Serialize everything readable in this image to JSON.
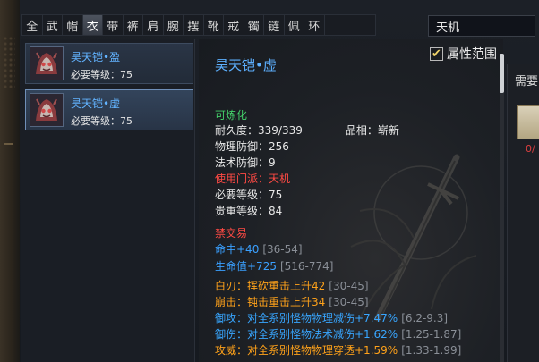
{
  "tabs": [
    "全",
    "武",
    "帽",
    "衣",
    "带",
    "裤",
    "肩",
    "腕",
    "摆",
    "靴",
    "戒",
    "镯",
    "链",
    "佩",
    "环"
  ],
  "active_tab_index": 3,
  "search": {
    "value": "天机"
  },
  "items": [
    {
      "name": "昊天铠•盈",
      "req": "必要等级：75",
      "selected": false
    },
    {
      "name": "昊天铠•虚",
      "req": "必要等级：75",
      "selected": true
    }
  ],
  "attr_filter": {
    "checked": true,
    "label": "属性范围",
    "check_glyph": "✔"
  },
  "detail": {
    "title": "昊天铠•虚",
    "refinable": "可炼化",
    "durability_label": "耐久度：339/339",
    "quality_label": "品相：崭新",
    "phys_def": "物理防御：256",
    "mag_def": "法术防御：9",
    "faction": "使用门派：天机",
    "req_level": "必要等级：75",
    "prestige_level": "贵重等级：84",
    "no_trade": "禁交易",
    "stats": [
      {
        "text": "命中+40",
        "range": "[36-54]",
        "color": "blue"
      },
      {
        "text": "生命值+725",
        "range": "[516-774]",
        "color": "blue"
      }
    ],
    "specials": [
      {
        "text": "白刃：挥砍重击上升42",
        "range": "[30-45]",
        "color": "orange"
      },
      {
        "text": "崩击：钝击重击上升34",
        "range": "[30-45]",
        "color": "orange"
      },
      {
        "text": "御攻：对全系别怪物物理减伤+7.47%",
        "range": "[6.2-9.3]",
        "color": "cyan"
      },
      {
        "text": "御伤：对全系别怪物法术减伤+1.62%",
        "range": "[1.25-1.87]",
        "color": "cyan"
      },
      {
        "text": "攻威：对全系别怪物物理穿透+1.59%",
        "range": "[1.33-1.99]",
        "color": "orange"
      }
    ]
  },
  "right_panel": {
    "label": "需要",
    "count": "0/"
  },
  "colors": {
    "item_name": "#62b3ff",
    "green": "#44d16a",
    "red": "#ff4a44",
    "blue": "#3aa0ff",
    "orange": "#ffa21a",
    "cyan": "#38a6ff",
    "range_gray": "#8a8f97"
  }
}
